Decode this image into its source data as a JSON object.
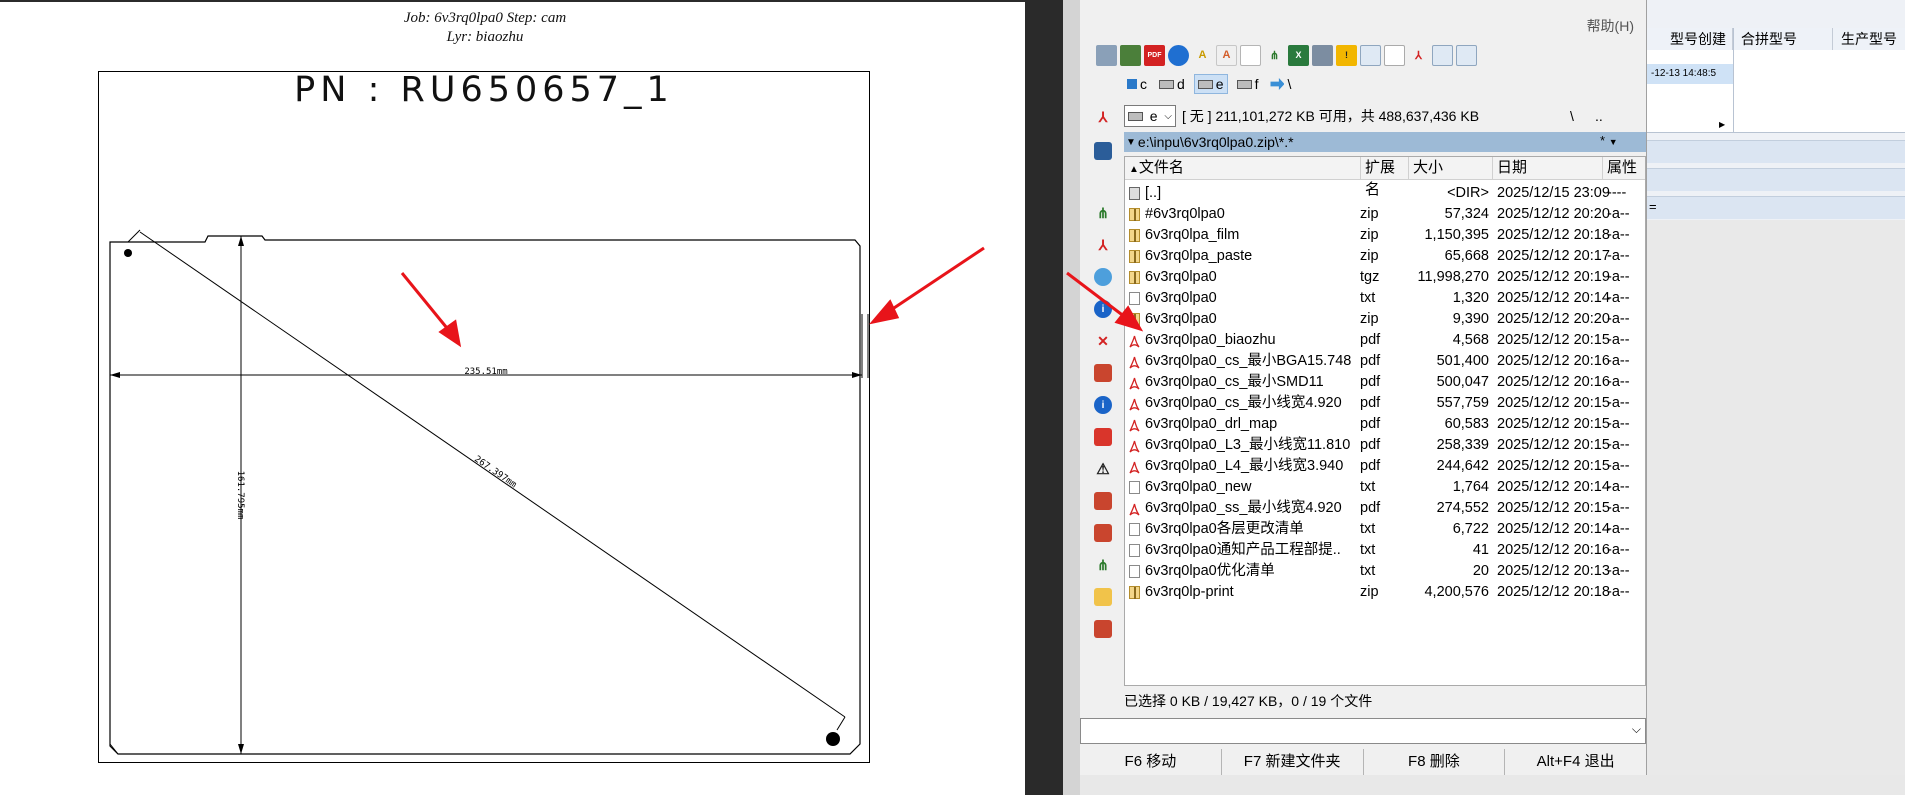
{
  "drawing": {
    "job_caption": "Job: 6v3rq0lpa0  Step: cam",
    "layer_caption": "Lyr: biaozhu",
    "part_number": "PN  :  RU650657_1",
    "dim_width": "235.51mm",
    "dim_height": "161.795mm",
    "dim_diagonal": "267.397mm"
  },
  "file_manager": {
    "help_menu": "帮助(H)",
    "drives": [
      {
        "letter": "c",
        "selected": false
      },
      {
        "letter": "d",
        "selected": false
      },
      {
        "letter": "e",
        "selected": true
      },
      {
        "letter": "f",
        "selected": false
      },
      {
        "letter": "\\",
        "selected": false
      }
    ],
    "current_drive": "e",
    "drive_info": "[ 无 ]  211,101,272 KB 可用，共 488,637,436 KB",
    "root_button": "\\",
    "parent_button": "..",
    "path": "e:\\inpu\\6v3rq0lpa0.zip\\*.*",
    "filter": "*",
    "columns": {
      "name": "文件名",
      "ext": "扩展名",
      "size": "大小",
      "date": "日期",
      "attr": "属性"
    },
    "rows": [
      {
        "icon": "up",
        "name": "[..]",
        "ext": "",
        "size": "<DIR>",
        "date": "2025/12/15 23:09",
        "attr": "----"
      },
      {
        "icon": "zip",
        "name": "#6v3rq0lpa0",
        "ext": "zip",
        "size": "57,324",
        "date": "2025/12/12 20:20",
        "attr": "-a--"
      },
      {
        "icon": "zip",
        "name": "6v3rq0lpa_film",
        "ext": "zip",
        "size": "1,150,395",
        "date": "2025/12/12 20:18",
        "attr": "-a--"
      },
      {
        "icon": "zip",
        "name": "6v3rq0lpa_paste",
        "ext": "zip",
        "size": "65,668",
        "date": "2025/12/12 20:17",
        "attr": "-a--"
      },
      {
        "icon": "zip",
        "name": "6v3rq0lpa0",
        "ext": "tgz",
        "size": "11,998,270",
        "date": "2025/12/12 20:19",
        "attr": "-a--"
      },
      {
        "icon": "txt",
        "name": "6v3rq0lpa0",
        "ext": "txt",
        "size": "1,320",
        "date": "2025/12/12 20:14",
        "attr": "-a--"
      },
      {
        "icon": "zip",
        "name": "6v3rq0lpa0",
        "ext": "zip",
        "size": "9,390",
        "date": "2025/12/12 20:20",
        "attr": "-a--"
      },
      {
        "icon": "pdf",
        "name": "6v3rq0lpa0_biaozhu",
        "ext": "pdf",
        "size": "4,568",
        "date": "2025/12/12 20:15",
        "attr": "-a--"
      },
      {
        "icon": "pdf",
        "name": "6v3rq0lpa0_cs_最小BGA15.748",
        "ext": "pdf",
        "size": "501,400",
        "date": "2025/12/12 20:16",
        "attr": "-a--"
      },
      {
        "icon": "pdf",
        "name": "6v3rq0lpa0_cs_最小SMD11",
        "ext": "pdf",
        "size": "500,047",
        "date": "2025/12/12 20:16",
        "attr": "-a--"
      },
      {
        "icon": "pdf",
        "name": "6v3rq0lpa0_cs_最小线宽4.920",
        "ext": "pdf",
        "size": "557,759",
        "date": "2025/12/12 20:15",
        "attr": "-a--"
      },
      {
        "icon": "pdf",
        "name": "6v3rq0lpa0_drl_map",
        "ext": "pdf",
        "size": "60,583",
        "date": "2025/12/12 20:15",
        "attr": "-a--"
      },
      {
        "icon": "pdf",
        "name": "6v3rq0lpa0_L3_最小线宽11.810",
        "ext": "pdf",
        "size": "258,339",
        "date": "2025/12/12 20:15",
        "attr": "-a--"
      },
      {
        "icon": "pdf",
        "name": "6v3rq0lpa0_L4_最小线宽3.940",
        "ext": "pdf",
        "size": "244,642",
        "date": "2025/12/12 20:15",
        "attr": "-a--"
      },
      {
        "icon": "txt",
        "name": "6v3rq0lpa0_new",
        "ext": "txt",
        "size": "1,764",
        "date": "2025/12/12 20:14",
        "attr": "-a--"
      },
      {
        "icon": "pdf",
        "name": "6v3rq0lpa0_ss_最小线宽4.920",
        "ext": "pdf",
        "size": "274,552",
        "date": "2025/12/12 20:15",
        "attr": "-a--"
      },
      {
        "icon": "txt",
        "name": "6v3rq0lpa0各层更改清单",
        "ext": "txt",
        "size": "6,722",
        "date": "2025/12/12 20:14",
        "attr": "-a--"
      },
      {
        "icon": "txt",
        "name": "6v3rq0lpa0通知产品工程部提..",
        "ext": "txt",
        "size": "41",
        "date": "2025/12/12 20:16",
        "attr": "-a--"
      },
      {
        "icon": "txt",
        "name": "6v3rq0lpa0优化清单",
        "ext": "txt",
        "size": "20",
        "date": "2025/12/12 20:13",
        "attr": "-a--"
      },
      {
        "icon": "zip",
        "name": "6v3rq0lp-print",
        "ext": "zip",
        "size": "4,200,576",
        "date": "2025/12/12 20:18",
        "attr": "-a--"
      }
    ],
    "status": "已选择 0 KB / 19,427 KB，0 / 19 个文件",
    "fkeys": [
      "F6 移动",
      "F7 新建文件夹",
      "F8 删除",
      "Alt+F4 退出"
    ]
  },
  "right_app": {
    "col1": "型号创建",
    "col2": "合拼型号",
    "col3": "生产型号",
    "selected_cell": "-12-13 14:48:5",
    "side_mark": "="
  },
  "colors": {
    "arrow": "#e8141a",
    "path_bar": "#9dbad6",
    "selection": "#cce0f5"
  }
}
